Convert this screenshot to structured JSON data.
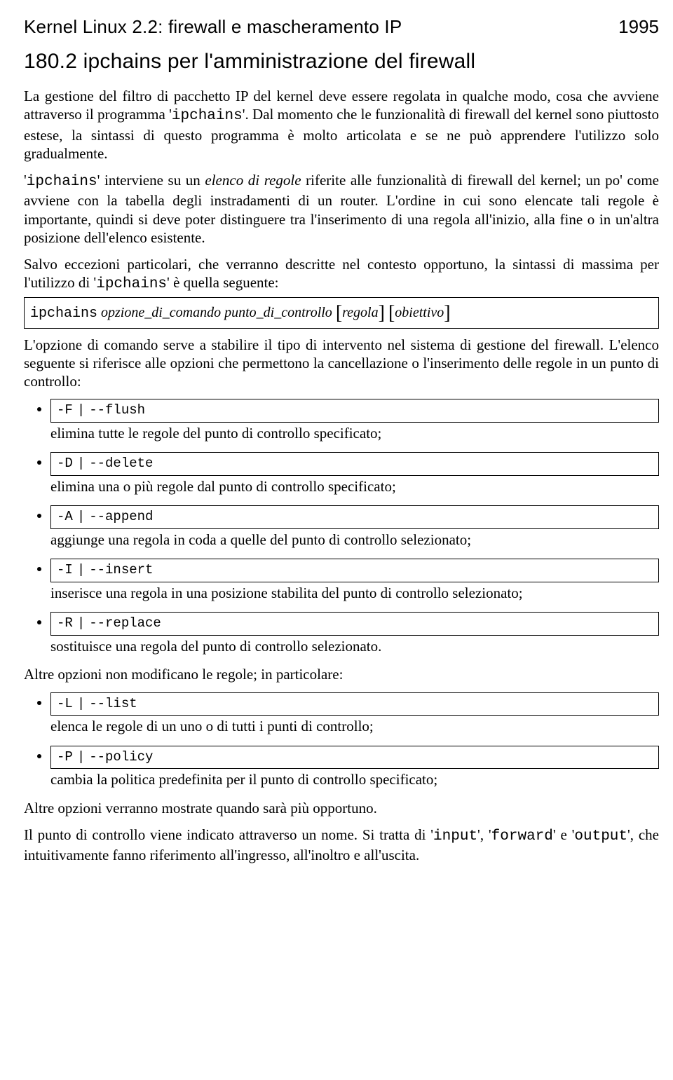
{
  "header": {
    "running_title": "Kernel Linux 2.2: firewall e mascheramento IP",
    "page_number": "1995"
  },
  "section": {
    "number": "180.2",
    "title": "ipchains per l'amministrazione del firewall"
  },
  "p1": {
    "a": "La gestione del filtro di pacchetto IP del kernel deve essere regolata in qualche modo, cosa che avviene attraverso il programma '",
    "cmd": "ipchains",
    "b": "'. Dal momento che le funzionalità di firewall del kernel sono piuttosto estese, la sintassi di questo programma è molto articolata e se ne può apprendere l'utilizzo solo gradualmente."
  },
  "p2": {
    "a": "'",
    "cmd": "ipchains",
    "b": "' interviene su un ",
    "em": "elenco di regole",
    "c": " riferite alle funzionalità di firewall del kernel; un po' come avviene con la tabella degli instradamenti di un router. L'ordine in cui sono elencate tali regole è importante, quindi si deve poter distinguere tra l'inserimento di una regola all'inizio, alla fine o in un'altra posizione dell'elenco esistente."
  },
  "p3": {
    "a": "Salvo eccezioni particolari, che verranno descritte nel contesto opportuno, la sintassi di massima per l'utilizzo di '",
    "cmd": "ipchains",
    "b": "' è quella seguente:"
  },
  "syntax": {
    "cmd": "ipchains",
    "arg1": "opzione_di_comando",
    "arg2": "punto_di_controllo",
    "lb1": "[",
    "opt1": "regola",
    "rb1": "]",
    "lb2": "[",
    "opt2": "obiettivo",
    "rb2": "]"
  },
  "p4": "L'opzione di comando serve a stabilire il tipo di intervento nel sistema di gestione del firewall. L'elenco seguente si riferisce alle opzioni che permettono la cancellazione o l'inserimento delle regole in un punto di controllo:",
  "opts1": [
    {
      "short": "-F",
      "long": "--flush",
      "desc": "elimina tutte le regole del punto di controllo specificato;"
    },
    {
      "short": "-D",
      "long": "--delete",
      "desc": "elimina una o più regole dal punto di controllo specificato;"
    },
    {
      "short": "-A",
      "long": "--append",
      "desc": "aggiunge una regola in coda a quelle del punto di controllo selezionato;"
    },
    {
      "short": "-I",
      "long": "--insert",
      "desc": "inserisce una regola in una posizione stabilita del punto di controllo selezionato;"
    },
    {
      "short": "-R",
      "long": "--replace",
      "desc": "sostituisce una regola del punto di controllo selezionato."
    }
  ],
  "p5": "Altre opzioni non modificano le regole; in particolare:",
  "opts2": [
    {
      "short": "-L",
      "long": "--list",
      "desc": "elenca le regole di un uno o di tutti i punti di controllo;"
    },
    {
      "short": "-P",
      "long": "--policy",
      "desc": "cambia la politica predefinita per il punto di controllo specificato;"
    }
  ],
  "p6": "Altre opzioni verranno mostrate quando sarà più opportuno.",
  "p7": {
    "a": "Il punto di controllo viene indicato attraverso un nome. Si tratta di '",
    "c1": "input",
    "b": "', '",
    "c2": "forward",
    "c": "' e '",
    "c3": "output",
    "d": "', che intuitivamente fanno riferimento all'ingresso, all'inoltro e all'uscita."
  },
  "sep": "|"
}
